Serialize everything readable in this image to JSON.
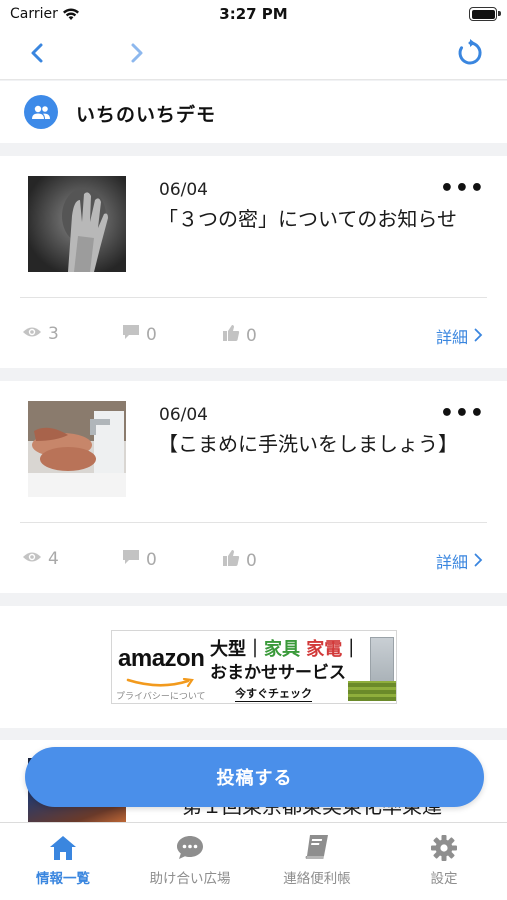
{
  "status_bar": {
    "carrier": "Carrier",
    "time": "3:27 PM"
  },
  "group": {
    "name": "いちのいちデモ"
  },
  "posts": [
    {
      "date": "06/04",
      "title": "「３つの密」についてのお知らせ",
      "views": "3",
      "comments": "0",
      "likes": "0",
      "detail_label": "詳細",
      "menu": "•••"
    },
    {
      "date": "06/04",
      "title": "【こまめに手洗いをしましょう】",
      "views": "4",
      "comments": "0",
      "likes": "0",
      "detail_label": "詳細",
      "menu": "•••"
    }
  ],
  "ad": {
    "logo": "amazon",
    "headline_prefix": "大型｜",
    "headline_green": "家具",
    "headline_space": " ",
    "headline_red": "家電",
    "headline_suffix": "｜",
    "subline": "おまかせサービス",
    "privacy": "プライバシーについて",
    "cta": "今すぐチェック"
  },
  "partial_post": {
    "title_fragment": "第１回東京都東実東化率東運",
    "menu": "•••"
  },
  "post_button_label": "投稿する",
  "tabs": [
    {
      "label": "情報一覧",
      "icon": "home-icon",
      "active": true
    },
    {
      "label": "助け合い広場",
      "icon": "chat-bubble-icon",
      "active": false
    },
    {
      "label": "連絡便利帳",
      "icon": "book-icon",
      "active": false
    },
    {
      "label": "設定",
      "icon": "gear-icon",
      "active": false
    }
  ],
  "colors": {
    "accent": "#3a86df",
    "button": "#4a8fea",
    "muted": "#a9a9a9"
  }
}
